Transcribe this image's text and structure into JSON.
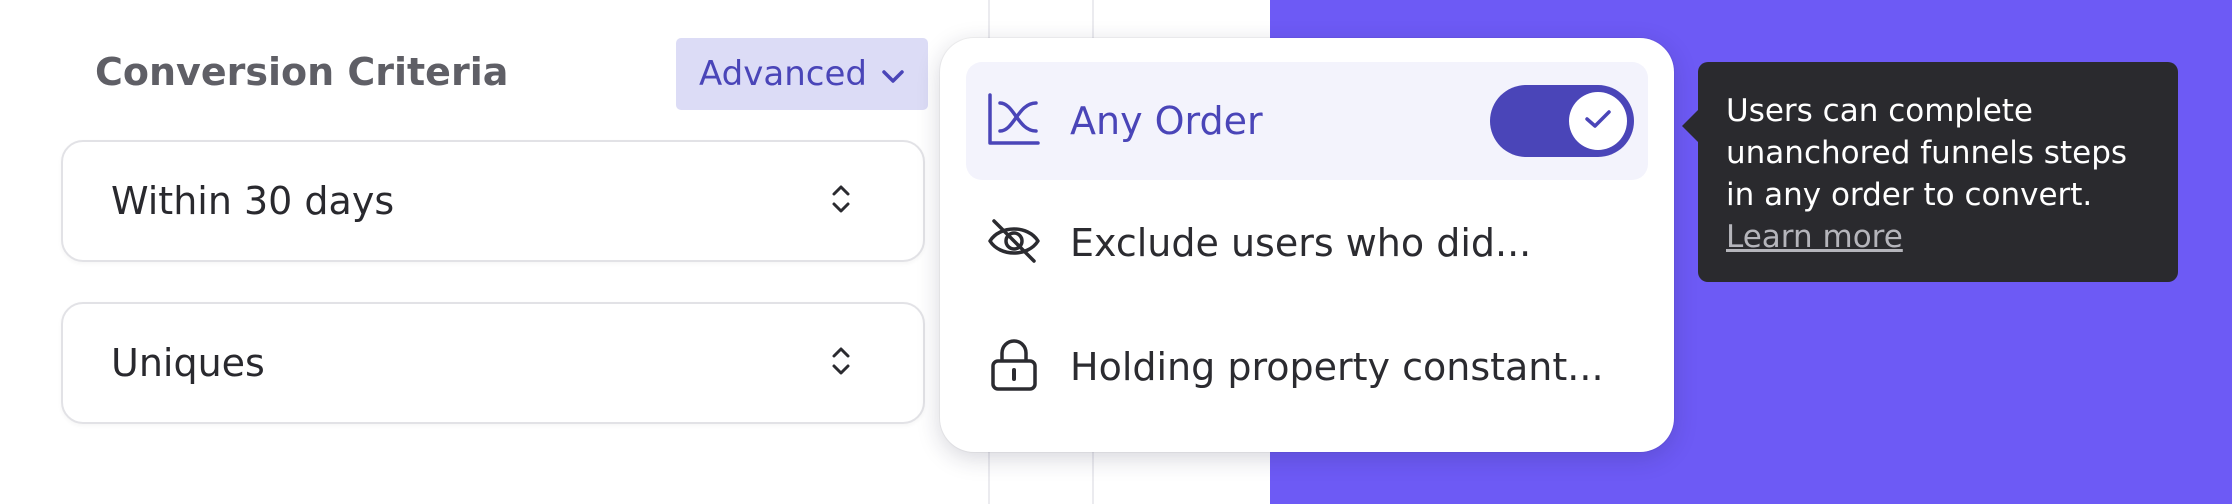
{
  "conversion": {
    "title": "Conversion Criteria",
    "advanced_label": "Advanced",
    "window_select": "Within 30 days",
    "count_select": "Uniques"
  },
  "menu": {
    "items": [
      {
        "label": "Any Order",
        "icon": "any-order-icon",
        "active": true,
        "toggle_on": true
      },
      {
        "label": "Exclude users who did...",
        "icon": "eye-slash-icon"
      },
      {
        "label": "Holding property constant...",
        "icon": "lock-icon"
      }
    ]
  },
  "tooltip": {
    "lines": [
      "Users can complete",
      "unanchored funnels steps",
      "in any order to convert."
    ],
    "link": "Learn more"
  },
  "colors": {
    "accent": "#4a45b8",
    "accent_light": "#dcdcf6",
    "background_panel": "#6d5af5",
    "tooltip_bg": "#2a2a2e"
  }
}
